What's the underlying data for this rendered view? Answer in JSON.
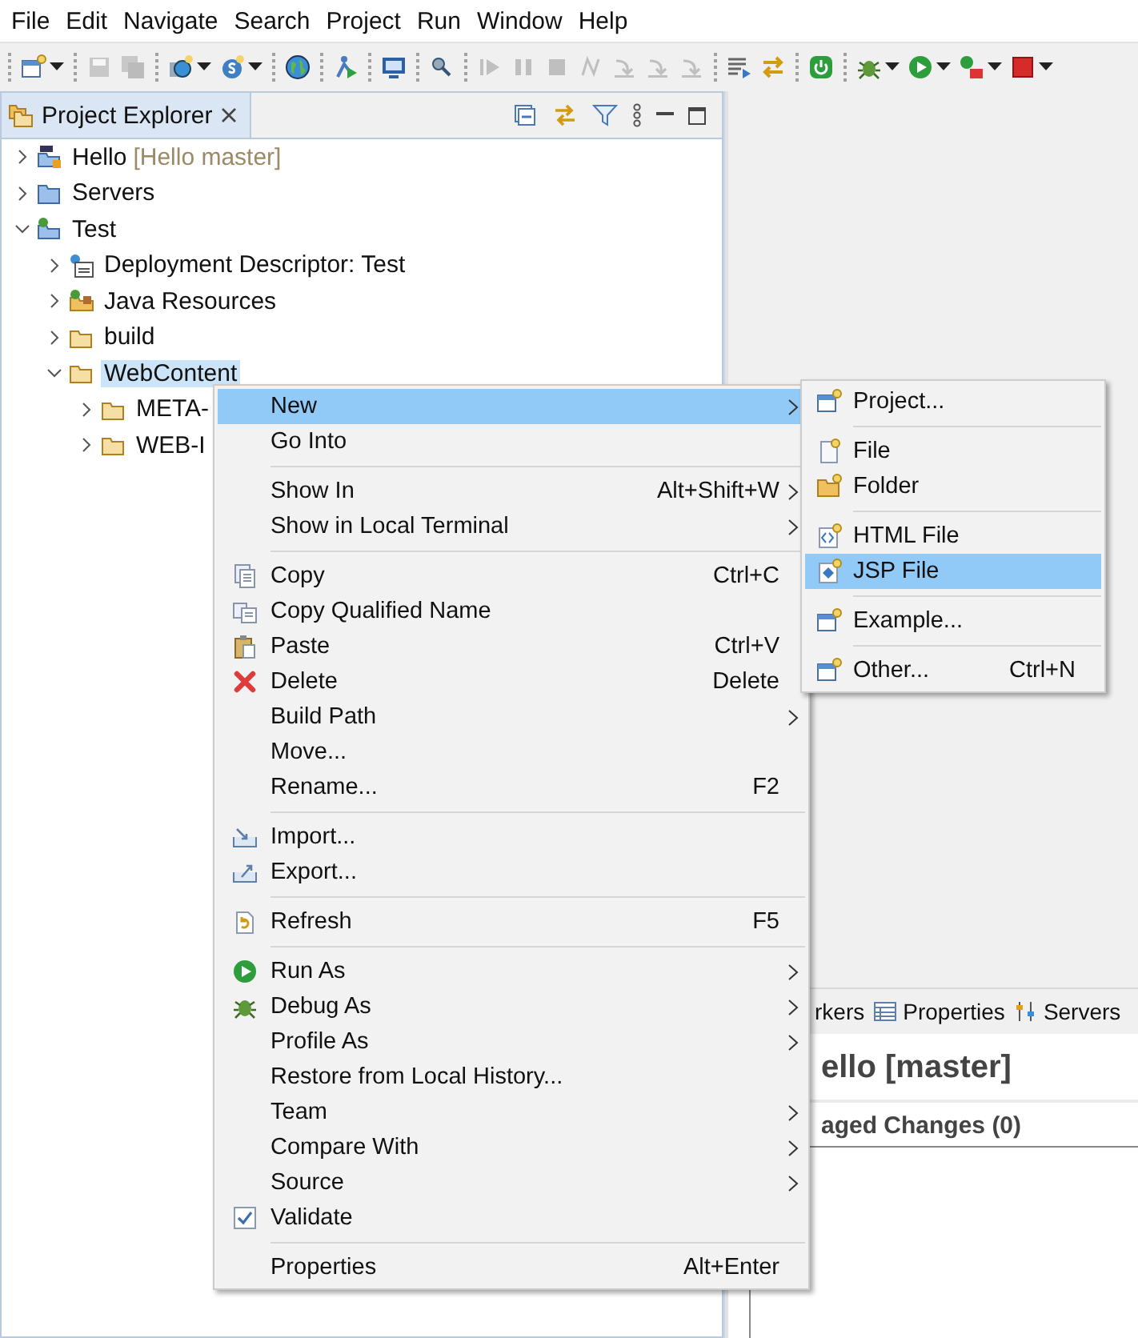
{
  "menubar": [
    {
      "label": "File"
    },
    {
      "label": "Edit"
    },
    {
      "label": "Navigate"
    },
    {
      "label": "Search"
    },
    {
      "label": "Project"
    },
    {
      "label": "Run"
    },
    {
      "label": "Window"
    },
    {
      "label": "Help"
    }
  ],
  "toolbar": [
    {
      "kind": "separator"
    },
    {
      "kind": "button",
      "disabled": false,
      "dropdown": true
    },
    {
      "kind": "separator"
    },
    {
      "kind": "button",
      "disabled": true,
      "dropdown": false
    },
    {
      "kind": "button",
      "disabled": true,
      "dropdown": false
    },
    {
      "kind": "separator"
    },
    {
      "kind": "button",
      "disabled": false,
      "dropdown": true
    },
    {
      "kind": "button",
      "disabled": false,
      "dropdown": true
    },
    {
      "kind": "separator"
    },
    {
      "kind": "button",
      "disabled": false,
      "dropdown": false
    },
    {
      "kind": "separator"
    },
    {
      "kind": "button",
      "disabled": false,
      "dropdown": false
    },
    {
      "kind": "separator"
    },
    {
      "kind": "button",
      "disabled": false,
      "dropdown": false
    },
    {
      "kind": "separator"
    },
    {
      "kind": "button",
      "disabled": false,
      "dropdown": false
    },
    {
      "kind": "separator"
    },
    {
      "kind": "button",
      "disabled": true,
      "dropdown": false
    },
    {
      "kind": "button",
      "disabled": true,
      "dropdown": false
    },
    {
      "kind": "button",
      "disabled": true,
      "dropdown": false
    },
    {
      "kind": "button",
      "disabled": true,
      "dropdown": false
    },
    {
      "kind": "button",
      "disabled": true,
      "dropdown": false
    },
    {
      "kind": "button",
      "disabled": true,
      "dropdown": false
    },
    {
      "kind": "button",
      "disabled": true,
      "dropdown": false
    },
    {
      "kind": "separator"
    },
    {
      "kind": "button",
      "disabled": false,
      "dropdown": false
    },
    {
      "kind": "button",
      "disabled": false,
      "dropdown": false
    },
    {
      "kind": "separator"
    },
    {
      "kind": "button",
      "disabled": false,
      "dropdown": false
    },
    {
      "kind": "separator"
    },
    {
      "kind": "button",
      "disabled": false,
      "dropdown": true
    },
    {
      "kind": "button",
      "disabled": false,
      "dropdown": true
    },
    {
      "kind": "button",
      "disabled": false,
      "dropdown": true
    },
    {
      "kind": "button",
      "disabled": false,
      "dropdown": true
    }
  ],
  "explorer": {
    "tab": {
      "title": "Project Explorer",
      "selected": true
    },
    "tree": [
      {
        "kind": "maven-project",
        "label": "Hello",
        "decoration": "[Hello master]",
        "expanded": false,
        "selected": false
      },
      {
        "kind": "folder-blue",
        "label": "Servers",
        "expanded": false,
        "selected": false
      },
      {
        "kind": "web-project",
        "label": "Test",
        "expanded": true,
        "selected": false,
        "children": [
          {
            "kind": "descriptor",
            "label": "Deployment Descriptor: Test",
            "expanded": false,
            "selected": false
          },
          {
            "kind": "resources",
            "label": "Java Resources",
            "expanded": false,
            "selected": false
          },
          {
            "kind": "folder",
            "label": "build",
            "expanded": false,
            "selected": false
          },
          {
            "kind": "folder",
            "label": "WebContent",
            "expanded": true,
            "selected": true,
            "children": [
              {
                "kind": "folder",
                "label": "META-",
                "expanded": false,
                "selected": false
              },
              {
                "kind": "folder",
                "label": "WEB-I",
                "expanded": false,
                "selected": false
              }
            ]
          }
        ]
      }
    ]
  },
  "lower_panel": {
    "tabs": [
      {
        "label": "rkers",
        "selected": false
      },
      {
        "label": "Properties",
        "selected": false
      },
      {
        "label": "Servers",
        "selected": false
      }
    ],
    "heading": "ello [master]",
    "section": "aged Changes (0)"
  },
  "context_menu": [
    {
      "kind": "item",
      "label": "New",
      "submenu": true,
      "selected": true
    },
    {
      "kind": "item",
      "label": "Go Into",
      "submenu": false,
      "selected": false
    },
    {
      "kind": "separator"
    },
    {
      "kind": "item",
      "label": "Show In",
      "shortcut": "Alt+Shift+W",
      "submenu": true,
      "selected": false
    },
    {
      "kind": "item",
      "label": "Show in Local Terminal",
      "submenu": true,
      "selected": false
    },
    {
      "kind": "separator"
    },
    {
      "kind": "item",
      "label": "Copy",
      "shortcut": "Ctrl+C",
      "submenu": false,
      "selected": false
    },
    {
      "kind": "item",
      "label": "Copy Qualified Name",
      "submenu": false,
      "selected": false
    },
    {
      "kind": "item",
      "label": "Paste",
      "shortcut": "Ctrl+V",
      "submenu": false,
      "selected": false
    },
    {
      "kind": "item",
      "label": "Delete",
      "shortcut": "Delete",
      "submenu": false,
      "selected": false
    },
    {
      "kind": "item",
      "label": "Build Path",
      "submenu": true,
      "selected": false
    },
    {
      "kind": "item",
      "label": "Move...",
      "submenu": false,
      "selected": false
    },
    {
      "kind": "item",
      "label": "Rename...",
      "shortcut": "F2",
      "submenu": false,
      "selected": false
    },
    {
      "kind": "separator"
    },
    {
      "kind": "item",
      "label": "Import...",
      "submenu": false,
      "selected": false
    },
    {
      "kind": "item",
      "label": "Export...",
      "submenu": false,
      "selected": false
    },
    {
      "kind": "separator"
    },
    {
      "kind": "item",
      "label": "Refresh",
      "shortcut": "F5",
      "submenu": false,
      "selected": false
    },
    {
      "kind": "separator"
    },
    {
      "kind": "item",
      "label": "Run As",
      "submenu": true,
      "selected": false
    },
    {
      "kind": "item",
      "label": "Debug As",
      "submenu": true,
      "selected": false
    },
    {
      "kind": "item",
      "label": "Profile As",
      "submenu": true,
      "selected": false
    },
    {
      "kind": "item",
      "label": "Restore from Local History...",
      "submenu": false,
      "selected": false
    },
    {
      "kind": "item",
      "label": "Team",
      "submenu": true,
      "selected": false
    },
    {
      "kind": "item",
      "label": "Compare With",
      "submenu": true,
      "selected": false
    },
    {
      "kind": "item",
      "label": "Source",
      "submenu": true,
      "selected": false
    },
    {
      "kind": "check",
      "label": "Validate",
      "checked": true,
      "submenu": false,
      "selected": false
    },
    {
      "kind": "separator"
    },
    {
      "kind": "item",
      "label": "Properties",
      "shortcut": "Alt+Enter",
      "submenu": false,
      "selected": false
    }
  ],
  "submenu": [
    {
      "kind": "item",
      "label": "Project...",
      "selected": false
    },
    {
      "kind": "separator"
    },
    {
      "kind": "item",
      "label": "File",
      "selected": false
    },
    {
      "kind": "item",
      "label": "Folder",
      "selected": false
    },
    {
      "kind": "separator"
    },
    {
      "kind": "item",
      "label": "HTML File",
      "selected": false
    },
    {
      "kind": "item",
      "label": "JSP File",
      "selected": true
    },
    {
      "kind": "separator"
    },
    {
      "kind": "item",
      "label": "Example...",
      "selected": false
    },
    {
      "kind": "separator"
    },
    {
      "kind": "item",
      "label": "Other...",
      "shortcut": "Ctrl+N",
      "selected": false
    }
  ]
}
